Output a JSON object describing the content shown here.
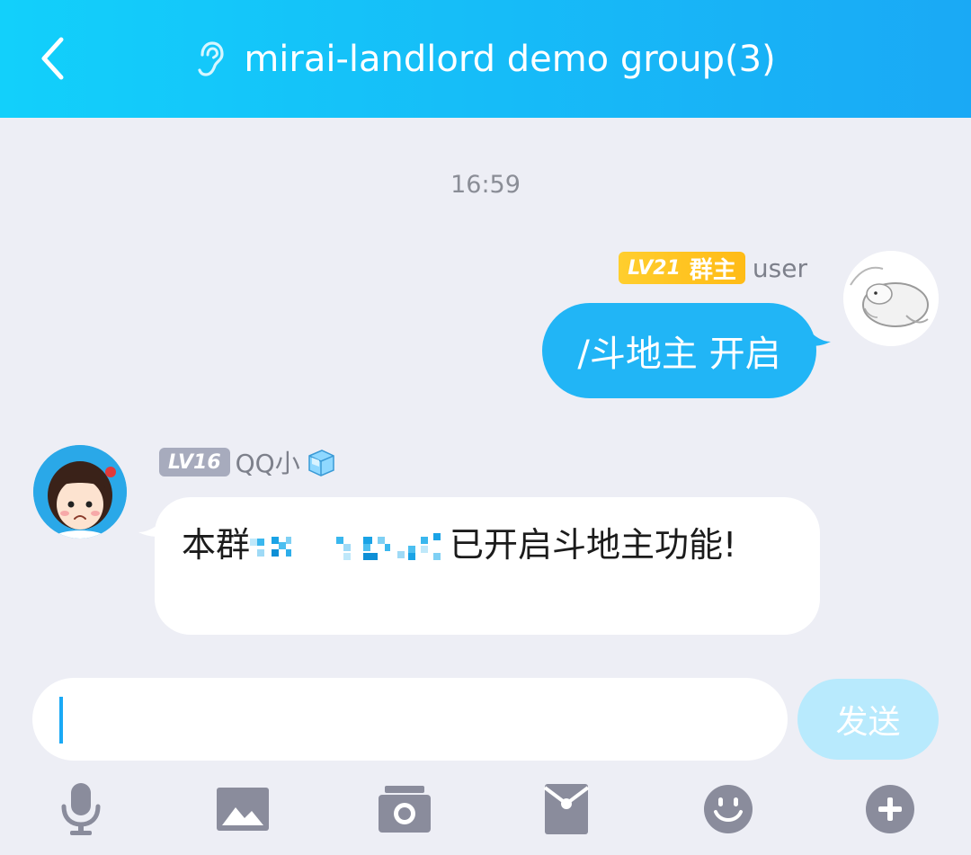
{
  "header": {
    "title": "mirai-landlord demo group(3)",
    "back_icon": "chevron-left-icon",
    "ear_icon": "ear-icon"
  },
  "timestamp": "16:59",
  "messages": [
    {
      "side": "right",
      "level_badge": "LV21",
      "role_badge": "群主",
      "sender": "user",
      "text": "/斗地主 开启"
    },
    {
      "side": "left",
      "level_badge": "LV16",
      "sender": "QQ小",
      "text_before": "本群",
      "text_after": "已开启斗地主功能!"
    }
  ],
  "composer": {
    "input_value": "",
    "send_label": "发送"
  },
  "toolbar": {
    "icons": [
      "microphone-icon",
      "image-icon",
      "camera-icon",
      "red-packet-icon",
      "emoji-icon",
      "plus-icon"
    ]
  },
  "colors": {
    "header_start": "#12d0fb",
    "header_end": "#1aa9f5",
    "bubble_right": "#21b5f6",
    "badge_gold": "#ffc21f",
    "badge_grey": "#a7abbd",
    "icon_grey": "#8a8c9c",
    "send_disabled": "#b8eafd"
  }
}
